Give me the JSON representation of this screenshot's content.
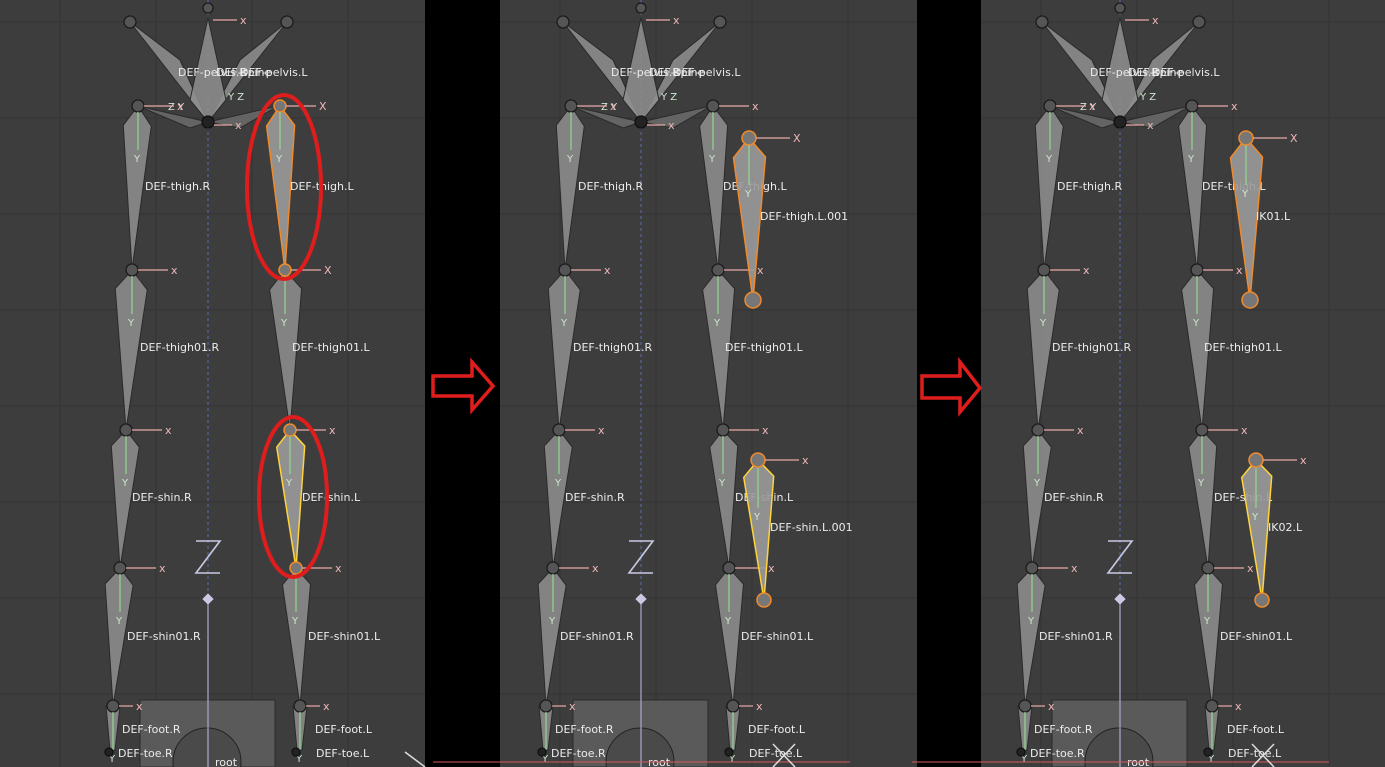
{
  "panels": [
    {
      "id": "before",
      "labels": {
        "pelvis_r": "DEF-pelvis.R",
        "spine": "DEF-spine",
        "pelvis_l": "DEF-pelvis.L",
        "thigh_r": "DEF-thigh.R",
        "thigh_l": "DEF-thigh.L",
        "thigh01_r": "DEF-thigh01.R",
        "thigh01_l": "DEF-thigh01.L",
        "shin_r": "DEF-shin.R",
        "shin_l": "DEF-shin.L",
        "shin01_r": "DEF-shin01.R",
        "shin01_l": "DEF-shin01.L",
        "foot_r": "DEF-foot.R",
        "foot_l": "DEF-foot.L",
        "toe_r": "DEF-toe.R",
        "toe_l": "DEF-toe.L",
        "root": "root"
      }
    },
    {
      "id": "duplicated",
      "labels": {
        "pelvis_r": "DEF-pelvis.R",
        "spine": "DEF-spine",
        "pelvis_l": "DEF-pelvis.L",
        "thigh_r": "DEF-thigh.R",
        "thigh_l": "DEF-thigh.L",
        "thigh01_r": "DEF-thigh01.R",
        "thigh01_l": "DEF-thigh01.L",
        "shin_r": "DEF-shin.R",
        "shin_l": "DEF-shin.L",
        "shin01_r": "DEF-shin01.R",
        "shin01_l": "DEF-shin01.L",
        "foot_r": "DEF-foot.R",
        "foot_l": "DEF-foot.L",
        "toe_r": "DEF-toe.R",
        "toe_l": "DEF-toe.L",
        "extra_thigh": "DEF-thigh.L.001",
        "extra_shin": "DEF-shin.L.001",
        "root": "root"
      }
    },
    {
      "id": "renamed",
      "labels": {
        "pelvis_r": "DEF-pelvis.R",
        "spine": "DEF-spine",
        "pelvis_l": "DEF-pelvis.L",
        "thigh_r": "DEF-thigh.R",
        "thigh_l": "DEF-thigh.L",
        "thigh01_r": "DEF-thigh01.R",
        "thigh01_l": "DEF-thigh01.L",
        "shin_r": "DEF-shin.R",
        "shin_l": "DEF-shin.L",
        "shin01_r": "DEF-shin01.R",
        "shin01_l": "DEF-shin01.L",
        "foot_r": "DEF-foot.R",
        "foot_l": "DEF-foot.L",
        "toe_r": "DEF-toe.R",
        "toe_l": "DEF-toe.L",
        "extra_thigh": "IK01.L",
        "extra_shin": "IK02.L",
        "root": "root"
      }
    }
  ],
  "axis_letters": {
    "x": "x",
    "X": "X",
    "y": "Y",
    "z": "Z"
  },
  "icons": {
    "step_arrow": "right-arrow-outline-icon",
    "highlight": "red-ellipse-highlight"
  },
  "colors": {
    "viewport": "#3d3d3d",
    "selected_orange": "#f08a2c",
    "selected_yellow": "#ffd33a",
    "highlight_red": "#e01d1d",
    "bone_y_axis": "#8fd88f",
    "bone_x_axis": "#e8a8a8"
  }
}
